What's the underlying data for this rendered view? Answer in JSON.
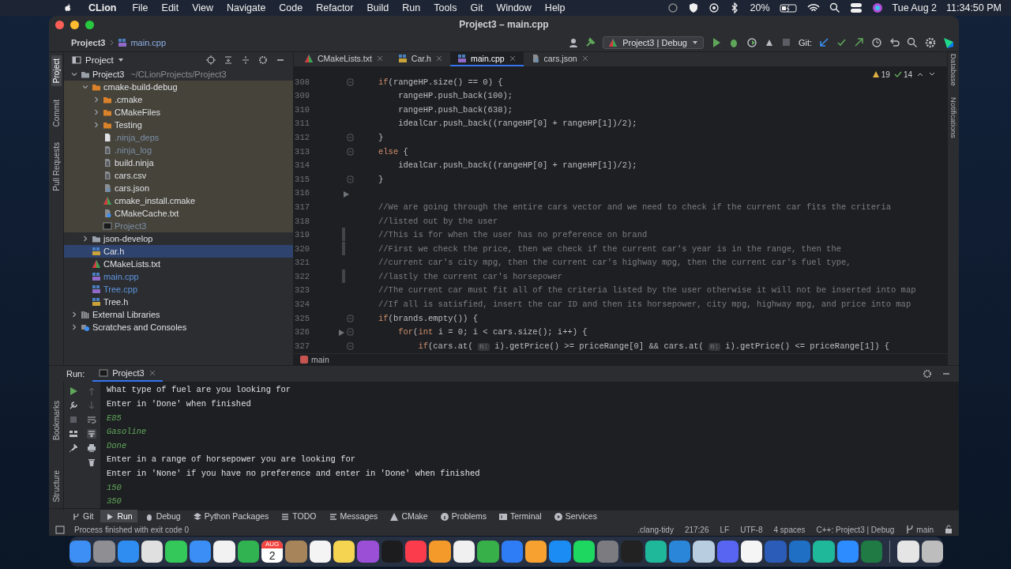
{
  "menubar": {
    "app": "CLion",
    "menus": [
      "File",
      "Edit",
      "View",
      "Navigate",
      "Code",
      "Refactor",
      "Build",
      "Run",
      "Tools",
      "Git",
      "Window",
      "Help"
    ],
    "battery": "20%",
    "date": "Tue Aug 2",
    "time": "11:34:50 PM"
  },
  "window": {
    "title": "Project3 – main.cpp"
  },
  "navbar": {
    "breadcrumb": [
      "Project3",
      "main.cpp"
    ],
    "run_config": "Project3 | Debug",
    "git_label": "Git:"
  },
  "left_strip": [
    {
      "label": "Project",
      "selected": true
    },
    {
      "label": "Commit",
      "selected": false
    },
    {
      "label": "Pull Requests",
      "selected": false
    }
  ],
  "right_strip": [
    "Database",
    "Notifications"
  ],
  "project_panel": {
    "title": "Project",
    "tree": [
      {
        "name": "Project3",
        "detail": "~/CLionProjects/Project3",
        "kind": "folder",
        "expanded": true,
        "selected": false,
        "children": [
          {
            "name": "cmake-build-debug",
            "kind": "build-folder",
            "expanded": true,
            "excluded": true,
            "selected": false,
            "children": [
              {
                "name": ".cmake",
                "kind": "build-folder",
                "expanded": false,
                "selected": false
              },
              {
                "name": "CMakeFiles",
                "kind": "build-folder",
                "expanded": false,
                "selected": false
              },
              {
                "name": "Testing",
                "kind": "build-folder",
                "expanded": false,
                "selected": false
              },
              {
                "name": ".ninja_deps",
                "kind": "file",
                "color": "#7d90a8",
                "selected": false
              },
              {
                "name": ".ninja_log",
                "kind": "text",
                "color": "#7d90a8",
                "selected": false
              },
              {
                "name": "build.ninja",
                "kind": "text",
                "selected": false
              },
              {
                "name": "cars.csv",
                "kind": "text",
                "selected": false
              },
              {
                "name": "cars.json",
                "kind": "json",
                "selected": false
              },
              {
                "name": "cmake_install.cmake",
                "kind": "cmake",
                "selected": false
              },
              {
                "name": "CMakeCache.txt",
                "kind": "settings",
                "selected": false
              },
              {
                "name": "Project3",
                "kind": "exe",
                "color": "#7d90a8",
                "selected": false
              }
            ]
          },
          {
            "name": "json-develop",
            "kind": "folder",
            "expanded": false,
            "selected": false
          },
          {
            "name": "Car.h",
            "kind": "header",
            "selected": true
          },
          {
            "name": "CMakeLists.txt",
            "kind": "cmake",
            "selected": false
          },
          {
            "name": "main.cpp",
            "kind": "cpp",
            "color": "#5f95e0",
            "selected": false
          },
          {
            "name": "Tree.cpp",
            "kind": "cpp",
            "color": "#5f95e0",
            "selected": false
          },
          {
            "name": "Tree.h",
            "kind": "header",
            "selected": false
          }
        ]
      },
      {
        "name": "External Libraries",
        "kind": "library",
        "expanded": false,
        "selected": false
      },
      {
        "name": "Scratches and Consoles",
        "kind": "scratches",
        "expanded": false,
        "selected": false
      }
    ]
  },
  "editor": {
    "tabs": [
      {
        "label": "CMakeLists.txt",
        "kind": "cmake",
        "selected": false
      },
      {
        "label": "Car.h",
        "kind": "header",
        "selected": false
      },
      {
        "label": "main.cpp",
        "kind": "cpp",
        "selected": true
      },
      {
        "label": "cars.json",
        "kind": "json",
        "selected": false
      }
    ],
    "warnings": "19",
    "weak_warnings": "14",
    "lines": [
      {
        "number": "308",
        "kind": "fold",
        "segments": [
          {
            "kind": "keyword",
            "t": "if"
          },
          {
            "kind": "plain",
            "t": "(rangeHP.size() == 0) {"
          }
        ]
      },
      {
        "number": "309",
        "kind": "plain",
        "segments": [
          {
            "kind": "plain",
            "t": "    rangeHP.push_back(100);"
          }
        ]
      },
      {
        "number": "310",
        "kind": "plain",
        "segments": [
          {
            "kind": "plain",
            "t": "    rangeHP.push_back(638);"
          }
        ]
      },
      {
        "number": "311",
        "kind": "plain",
        "segments": [
          {
            "kind": "plain",
            "t": "    idealCar.push_back((rangeHP[0] + rangeHP[1])/2);"
          }
        ]
      },
      {
        "number": "312",
        "kind": "fold",
        "segments": [
          {
            "kind": "plain",
            "t": "}"
          }
        ]
      },
      {
        "number": "313",
        "kind": "fold",
        "segments": [
          {
            "kind": "keyword",
            "t": "else"
          },
          {
            "kind": "plain",
            "t": " {"
          }
        ]
      },
      {
        "number": "314",
        "kind": "plain",
        "segments": [
          {
            "kind": "plain",
            "t": "    idealCar.push_back((rangeHP[0] + rangeHP[1])/2);"
          }
        ]
      },
      {
        "number": "315",
        "kind": "fold",
        "segments": [
          {
            "kind": "plain",
            "t": "}"
          }
        ]
      },
      {
        "number": "316",
        "kind": "run"
      },
      {
        "number": "317",
        "kind": "plain",
        "segments": [
          {
            "kind": "comment",
            "t": "//We are going through the entire cars vector and we need to check if the current car fits the criteria"
          }
        ]
      },
      {
        "number": "318",
        "kind": "plain",
        "segments": [
          {
            "kind": "comment",
            "t": "//listed out by the user"
          }
        ]
      },
      {
        "number": "319",
        "kind": "changed",
        "segments": [
          {
            "kind": "comment",
            "t": "//This is for when the user has no preference on brand"
          }
        ]
      },
      {
        "number": "320",
        "kind": "changed",
        "segments": [
          {
            "kind": "comment",
            "t": "//First we check the price, then we check if the current car's year is in the range, then the"
          }
        ]
      },
      {
        "number": "321",
        "kind": "plain",
        "segments": [
          {
            "kind": "comment",
            "t": "//current car's city mpg, then the current car's highway mpg, then the current car's fuel type,"
          }
        ]
      },
      {
        "number": "322",
        "kind": "changed",
        "segments": [
          {
            "kind": "comment",
            "t": "//lastly the current car's horsepower"
          }
        ]
      },
      {
        "number": "323",
        "kind": "plain",
        "segments": [
          {
            "kind": "comment",
            "t": "//The current car must fit all of the criteria listed by the user otherwise it will not be inserted into map"
          }
        ]
      },
      {
        "number": "324",
        "kind": "plain",
        "segments": [
          {
            "kind": "comment",
            "t": "//If all is satisfied, insert the car ID and then its horsepower, city mpg, highway mpg, and price into map"
          }
        ]
      },
      {
        "number": "325",
        "kind": "fold",
        "segments": [
          {
            "kind": "keyword",
            "t": "if"
          },
          {
            "kind": "plain",
            "t": "(brands.empty()) {"
          }
        ]
      },
      {
        "number": "326",
        "kind": "fold-run",
        "segments": [
          {
            "kind": "keyword",
            "t": "    for"
          },
          {
            "kind": "plain",
            "t": "("
          },
          {
            "kind": "keyword",
            "t": "int"
          },
          {
            "kind": "plain",
            "t": " i = 0; i < cars.size(); i++) {"
          }
        ]
      },
      {
        "number": "327",
        "kind": "fold",
        "segments": [
          {
            "kind": "keyword",
            "t": "        if"
          },
          {
            "kind": "plain",
            "t": "(cars.at( "
          },
          {
            "kind": "hint",
            "t": "n:"
          },
          {
            "kind": "plain",
            "t": " i).getPrice() >= priceRange[0] && cars.at( "
          },
          {
            "kind": "hint",
            "t": "n:"
          },
          {
            "kind": "plain",
            "t": " i).getPrice() <= priceRange[1]) {"
          }
        ]
      }
    ],
    "breadcrumb": "main"
  },
  "run_panel": {
    "label": "Run:",
    "tab": "Project3",
    "side_strip": [
      "Bookmarks",
      "Structure"
    ],
    "console": [
      {
        "kind": "output",
        "text": "What type of fuel are you looking for"
      },
      {
        "kind": "output",
        "text": "Enter in 'Done' when finished"
      },
      {
        "kind": "input",
        "text": "E85"
      },
      {
        "kind": "input",
        "text": "Gasoline"
      },
      {
        "kind": "input",
        "text": "Done"
      },
      {
        "kind": "output",
        "text": "Enter in a range of horsepower you are looking for"
      },
      {
        "kind": "output",
        "text": "Enter in 'None' if you have no preference and enter in 'Done' when finished"
      },
      {
        "kind": "input",
        "text": "150"
      },
      {
        "kind": "input",
        "text": "350"
      }
    ]
  },
  "tool_tabs": [
    {
      "label": "Git",
      "kind": "git",
      "selected": false
    },
    {
      "label": "Run",
      "kind": "run",
      "selected": true
    },
    {
      "label": "Debug",
      "kind": "bug",
      "selected": false
    },
    {
      "label": "Python Packages",
      "kind": "layers",
      "selected": false
    },
    {
      "label": "TODO",
      "kind": "list",
      "selected": false
    },
    {
      "label": "Messages",
      "kind": "lines",
      "selected": false
    },
    {
      "label": "CMake",
      "kind": "cmake",
      "selected": false
    },
    {
      "label": "Problems",
      "kind": "info",
      "selected": false
    },
    {
      "label": "Terminal",
      "kind": "terminal",
      "selected": false
    },
    {
      "label": "Services",
      "kind": "services",
      "selected": false
    }
  ],
  "status_bar": {
    "message": "Process finished with exit code 0",
    "items": [
      ".clang-tidy",
      "217:26",
      "LF",
      "UTF-8",
      "4 spaces",
      "C++: Project3 | Debug"
    ],
    "branch": "main"
  },
  "dock": [
    {
      "kind": "app",
      "color": "#3d8ff5"
    },
    {
      "kind": "app",
      "color": "#8e8e93"
    },
    {
      "kind": "app",
      "color": "#2f8cf0"
    },
    {
      "kind": "app",
      "color": "#e0e0e0"
    },
    {
      "kind": "app",
      "color": "#34c759"
    },
    {
      "kind": "app",
      "color": "#3a8ef6"
    },
    {
      "kind": "app",
      "color": "#f2f2f2"
    },
    {
      "kind": "app",
      "color": "#30b350"
    },
    {
      "kind": "calendar",
      "month": "AUG",
      "day": "2"
    },
    {
      "kind": "app",
      "color": "#a8845a"
    },
    {
      "kind": "app",
      "color": "#f4f4f4"
    },
    {
      "kind": "app",
      "color": "#f5d451"
    },
    {
      "kind": "app",
      "color": "#9b4fd6"
    },
    {
      "kind": "app",
      "color": "#1c1c1e"
    },
    {
      "kind": "app",
      "color": "#fa3c4c"
    },
    {
      "kind": "app",
      "color": "#f39a2b"
    },
    {
      "kind": "app",
      "color": "#f0f0f0"
    },
    {
      "kind": "app",
      "color": "#38b04a"
    },
    {
      "kind": "app",
      "color": "#2f7df6"
    },
    {
      "kind": "app",
      "color": "#f7a230"
    },
    {
      "kind": "app",
      "color": "#1c8cf5"
    },
    {
      "kind": "app",
      "color": "#1ed760"
    },
    {
      "kind": "app",
      "color": "#7c7c80"
    },
    {
      "kind": "app",
      "color": "#222222"
    },
    {
      "kind": "app",
      "color": "#1fb89a"
    },
    {
      "kind": "app",
      "color": "#2a86d8"
    },
    {
      "kind": "app",
      "color": "#b8cde0"
    },
    {
      "kind": "app",
      "color": "#5865f2"
    },
    {
      "kind": "app",
      "color": "#f5f5f5"
    },
    {
      "kind": "app",
      "color": "#2b5cb8"
    },
    {
      "kind": "app",
      "color": "#1f6fc5"
    },
    {
      "kind": "app",
      "color": "#1fb89a"
    },
    {
      "kind": "app",
      "color": "#2d8cff"
    },
    {
      "kind": "app",
      "color": "#1f7a44"
    },
    {
      "kind": "separator"
    },
    {
      "kind": "app",
      "color": "#e5e5e5"
    },
    {
      "kind": "app",
      "color": "#bdbdbd"
    }
  ]
}
